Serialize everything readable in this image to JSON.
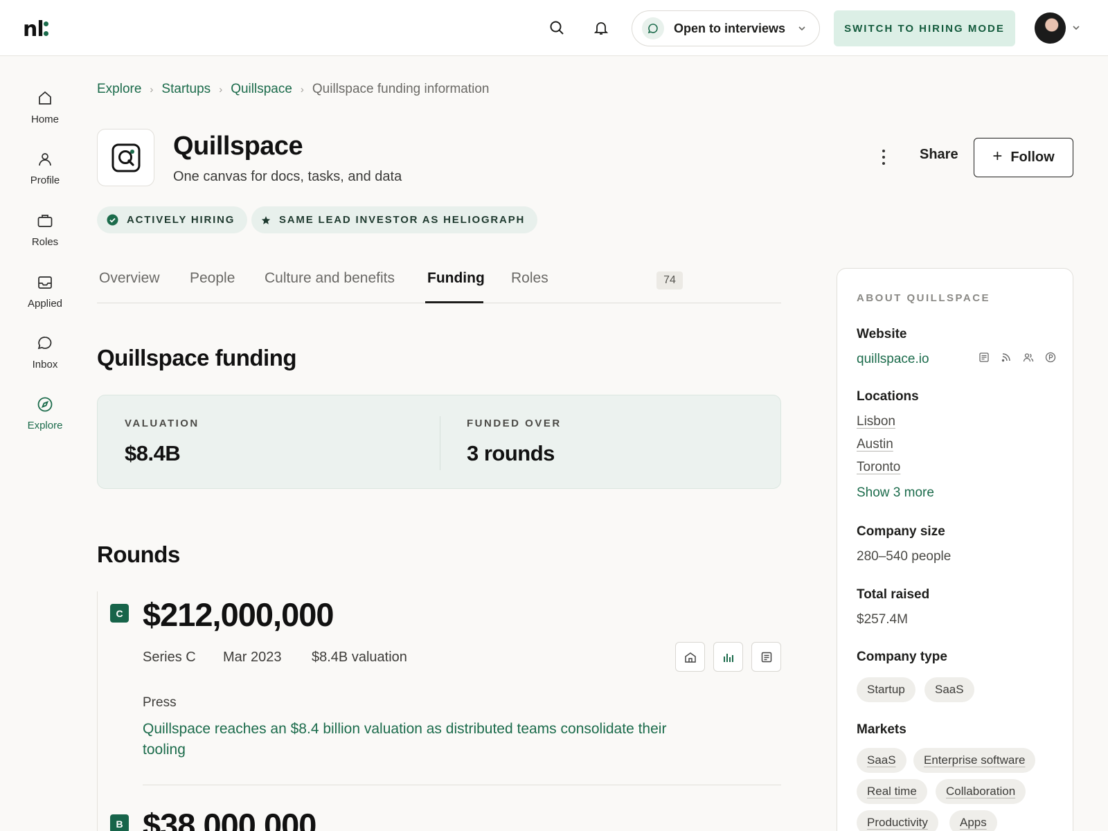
{
  "app": {
    "logo_text": "nl"
  },
  "topbar": {
    "status_label": "Open to interviews",
    "hiring_mode_label": "SWITCH TO HIRING MODE"
  },
  "sidebar": {
    "items": [
      {
        "label": "Home",
        "icon": "home-icon"
      },
      {
        "label": "Profile",
        "icon": "user-icon"
      },
      {
        "label": "Roles",
        "icon": "briefcase-icon"
      },
      {
        "label": "Applied",
        "icon": "inbox-tray-icon"
      },
      {
        "label": "Inbox",
        "icon": "chat-bubble-icon"
      },
      {
        "label": "Explore",
        "icon": "compass-icon",
        "active": true
      }
    ]
  },
  "breadcrumb": [
    "Explore",
    "Startups",
    "Quillspace",
    "Quillspace funding information"
  ],
  "company": {
    "name": "Quillspace",
    "tagline": "One canvas for docs, tasks, and data",
    "share_label": "Share",
    "follow_label": "Follow"
  },
  "badges": [
    {
      "label": "ACTIVELY HIRING",
      "icon": "check-circle-icon"
    },
    {
      "label": "SAME LEAD INVESTOR AS HELIOGRAPH",
      "icon": "star-icon"
    }
  ],
  "tabs": [
    {
      "label": "Overview"
    },
    {
      "label": "People"
    },
    {
      "label": "Culture and benefits"
    },
    {
      "label": "Funding",
      "active": true
    },
    {
      "label": "Roles",
      "count": "74"
    }
  ],
  "funding": {
    "title": "Quillspace funding",
    "valuation_label": "VALUATION",
    "valuation_value": "$8.4B",
    "funded_label": "FUNDED OVER",
    "funded_value": "3 rounds"
  },
  "rounds": {
    "title": "Rounds",
    "items": [
      {
        "badge": "C",
        "amount": "$212,000,000",
        "series": "Series C",
        "date": "Mar 2023",
        "valuation": "$8.4B valuation",
        "press_label": "Press",
        "press_link": "Quillspace reaches an $8.4 billion valuation as distributed teams consolidate their tooling"
      },
      {
        "badge": "B",
        "amount": "$38,000,000"
      }
    ]
  },
  "about": {
    "title": "ABOUT QUILLSPACE",
    "website_label": "Website",
    "website": "quillspace.io",
    "locations_label": "Locations",
    "locations": [
      "Lisbon",
      "Austin",
      "Toronto"
    ],
    "show_more": "Show 3 more",
    "size_label": "Company size",
    "size": "280–540 people",
    "raised_label": "Total raised",
    "raised": "$257.4M",
    "type_label": "Company type",
    "types": [
      "Startup",
      "SaaS"
    ],
    "markets_label": "Markets",
    "markets": [
      "SaaS",
      "Enterprise software",
      "Real time",
      "Collaboration",
      "Productivity",
      "Apps"
    ]
  },
  "colors": {
    "accent": "#1b6b4b",
    "hiring_btn_bg": "#dcefe6",
    "stats_bg": "#ecf2ef",
    "round_badge": "#17644a"
  }
}
